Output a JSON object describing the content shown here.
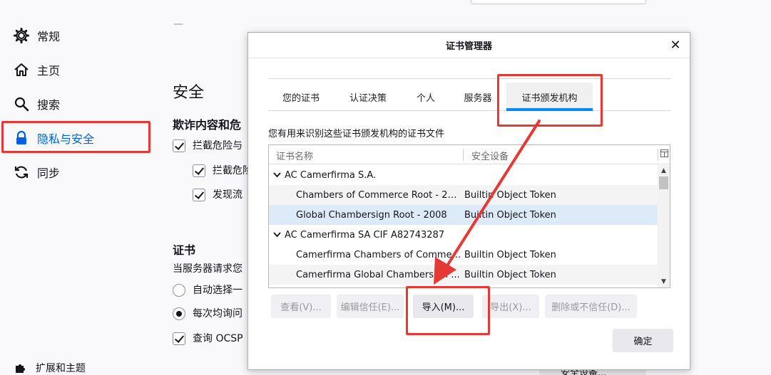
{
  "sidebar": {
    "items": [
      {
        "label": "常规",
        "icon": "gear-icon"
      },
      {
        "label": "主页",
        "icon": "home-icon"
      },
      {
        "label": "搜索",
        "icon": "search-icon"
      },
      {
        "label": "隐私与安全",
        "icon": "lock-icon"
      },
      {
        "label": "同步",
        "icon": "sync-icon"
      }
    ],
    "footer_label": "扩展和主题"
  },
  "prefs": {
    "dash": "—",
    "security_heading": "安全",
    "deceptive_heading": "欺诈内容和危",
    "block_dangerous": "拦截危险与",
    "block_dangerous_sub": "拦截危险",
    "warn_unwanted": "发现流",
    "cert_heading": "证书",
    "cert_desc": "当服务器请求您",
    "auto_select": "自动选择一",
    "ask_every_time": "每次均询问",
    "query_ocsp": "查询 OCSP",
    "bottom_button": "安全设备..."
  },
  "dialog": {
    "title": "证书管理器",
    "close_glyph": "✕",
    "tabs": [
      "您的证书",
      "认证决策",
      "个人",
      "服务器",
      "证书颁发机构"
    ],
    "active_tab": "证书颁发机构",
    "description": "您有用来识别这些证书颁发机构的证书文件",
    "columns": {
      "name": "证书名称",
      "device": "安全设备"
    },
    "rows": [
      {
        "type": "group",
        "name": "AC Camerfirma S.A."
      },
      {
        "type": "item",
        "name": "Chambers of Commerce Root - 20...",
        "device": "Builtin Object Token"
      },
      {
        "type": "item",
        "name": "Global Chambersign Root - 2008",
        "device": "Builtin Object Token"
      },
      {
        "type": "group",
        "name": "AC Camerfirma SA CIF A82743287"
      },
      {
        "type": "item",
        "name": "Camerfirma Chambers of Comme...",
        "device": "Builtin Object Token"
      },
      {
        "type": "item",
        "name": "Camerfirma Global Chambersign ...",
        "device": "Builtin Object Token"
      }
    ],
    "buttons": {
      "view": "查看(V)...",
      "edit_trust": "编辑信任(E)...",
      "import": "导入(M)...",
      "export": "导出(X)...",
      "delete": "删除或不信任(D)..."
    },
    "ok": "确定"
  },
  "colors": {
    "annotation": "#e53935",
    "active_nav": "#0061e0",
    "tab_underline": "#0a84ff"
  }
}
